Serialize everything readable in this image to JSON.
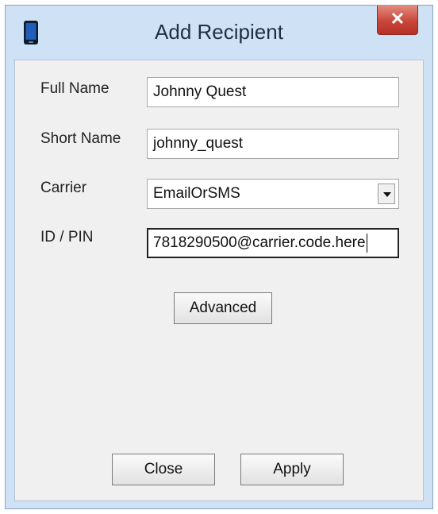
{
  "window": {
    "title": "Add Recipient",
    "close_glyph": "✕",
    "app_icon": "phone-icon"
  },
  "form": {
    "full_name": {
      "label": "Full Name",
      "value": "Johnny Quest"
    },
    "short_name": {
      "label": "Short Name",
      "value": "johnny_quest"
    },
    "carrier": {
      "label": "Carrier",
      "value": "EmailOrSMS"
    },
    "id_pin": {
      "label": "ID / PIN",
      "value": "7818290500@carrier.code.here"
    }
  },
  "buttons": {
    "advanced": "Advanced",
    "close": "Close",
    "apply": "Apply"
  },
  "colors": {
    "frame": "#cfe1f4",
    "close_button": "#c9463a",
    "client": "#f0f0f0"
  }
}
